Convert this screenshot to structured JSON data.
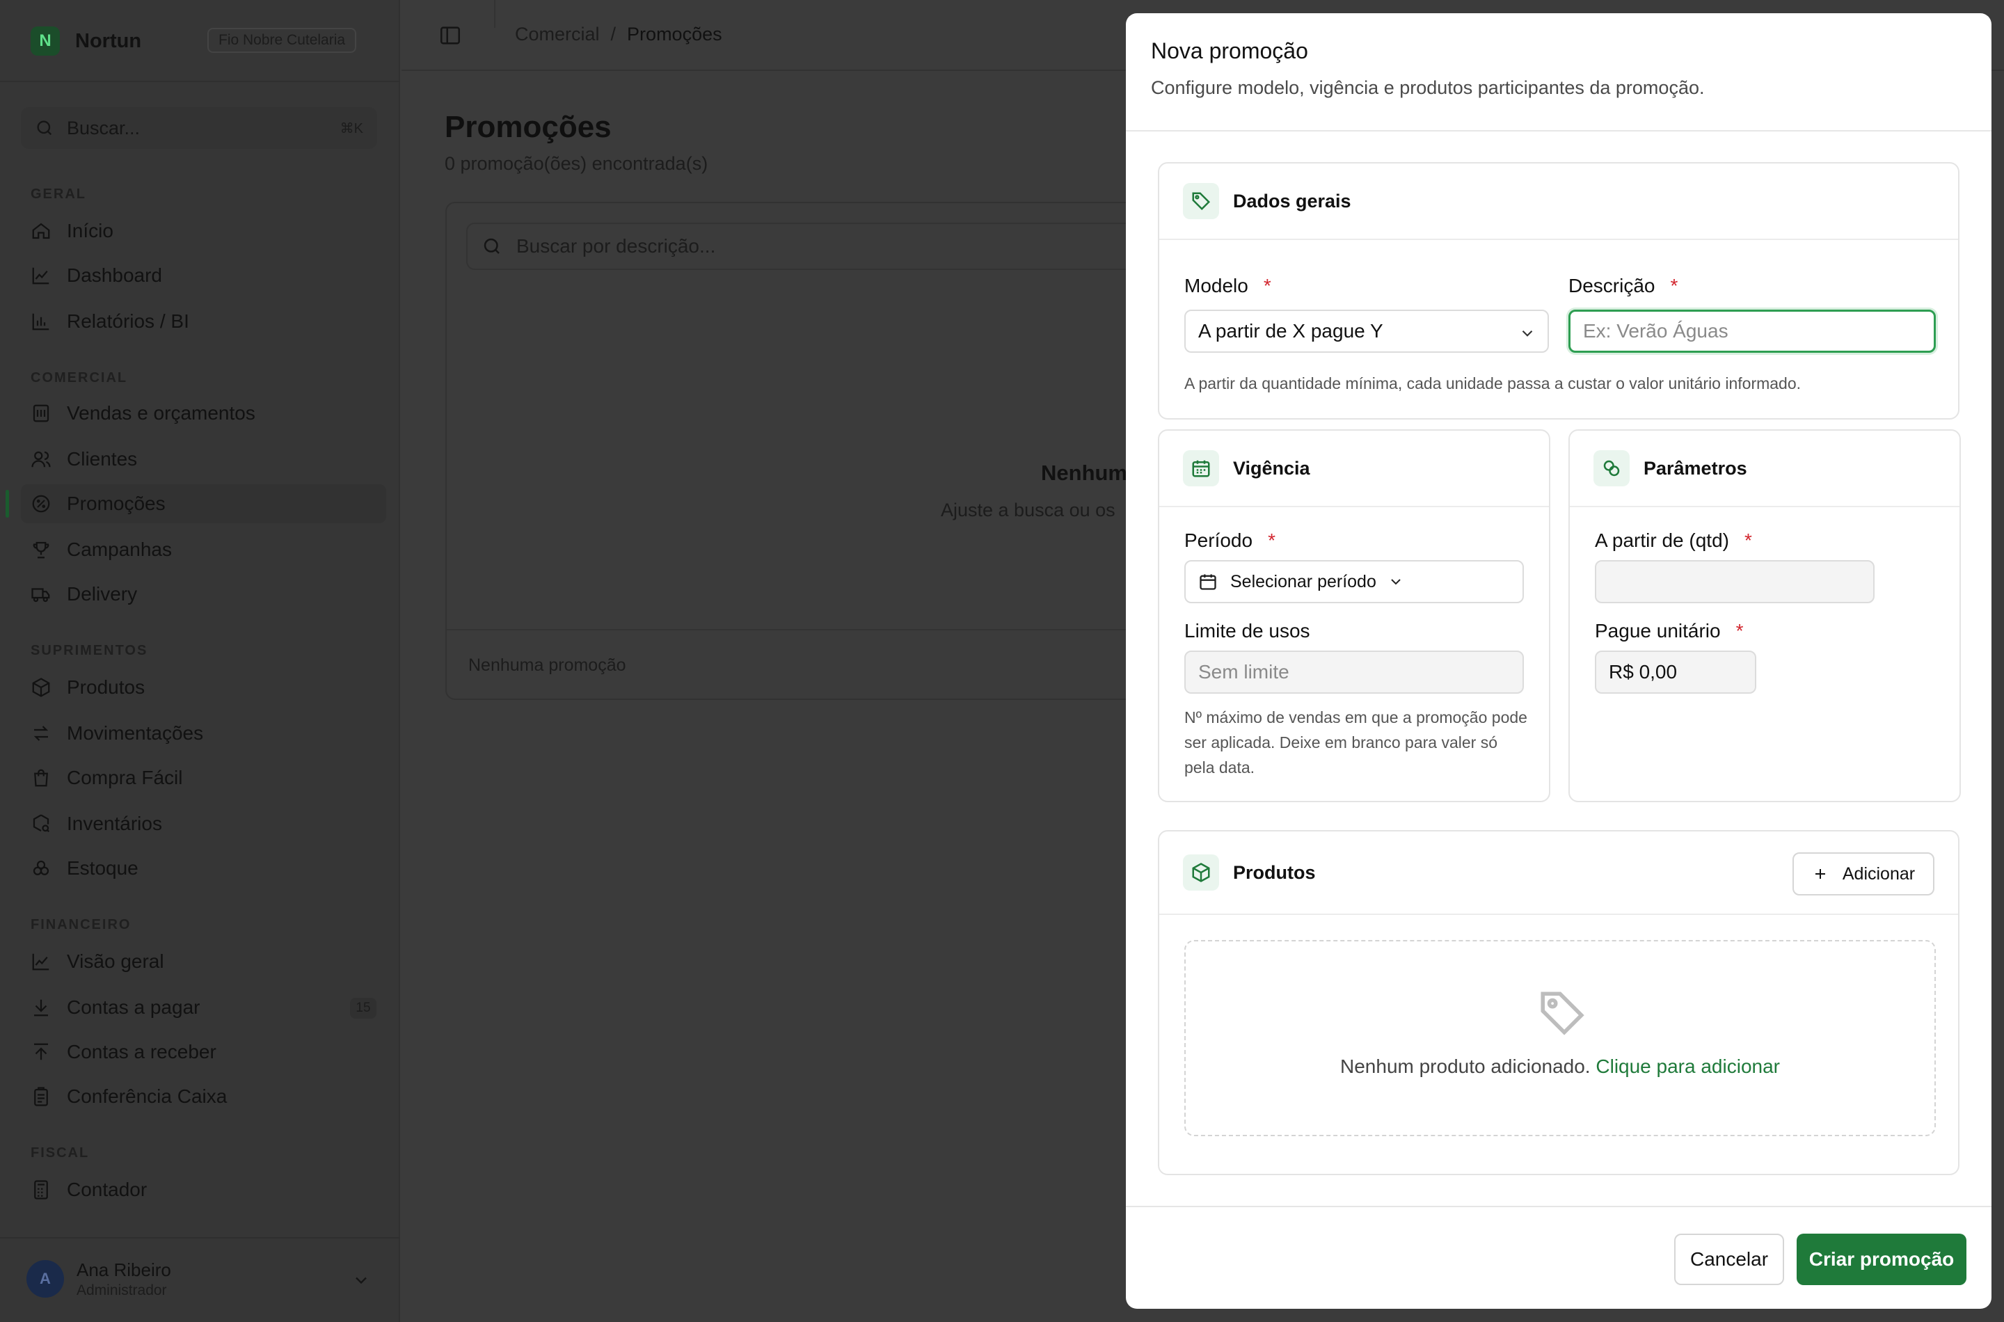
{
  "app": {
    "name": "Nortun",
    "tenant": "Fio Nobre Cutelaria",
    "search_placeholder": "Buscar...",
    "search_shortcut": "⌘K"
  },
  "sidebar": {
    "sections": [
      {
        "title": "GERAL",
        "items": [
          {
            "label": "Início",
            "icon": "home-icon"
          },
          {
            "label": "Dashboard",
            "icon": "line-chart-icon"
          },
          {
            "label": "Relatórios / BI",
            "icon": "bar-chart-icon"
          }
        ]
      },
      {
        "title": "COMERCIAL",
        "items": [
          {
            "label": "Vendas e orçamentos",
            "icon": "receipt-icon"
          },
          {
            "label": "Clientes",
            "icon": "users-icon"
          },
          {
            "label": "Promoções",
            "icon": "discount-icon",
            "active": true
          },
          {
            "label": "Campanhas",
            "icon": "trophy-icon"
          },
          {
            "label": "Delivery",
            "icon": "truck-icon"
          }
        ]
      },
      {
        "title": "SUPRIMENTOS",
        "items": [
          {
            "label": "Produtos",
            "icon": "package-icon"
          },
          {
            "label": "Movimentações",
            "icon": "arrows-icon"
          },
          {
            "label": "Compra Fácil",
            "icon": "shopping-bag-icon"
          },
          {
            "label": "Inventários",
            "icon": "box-search-icon"
          },
          {
            "label": "Estoque",
            "icon": "boxes-icon"
          }
        ]
      },
      {
        "title": "FINANCEIRO",
        "items": [
          {
            "label": "Visão geral",
            "icon": "line-chart-icon"
          },
          {
            "label": "Contas a pagar",
            "icon": "download-icon",
            "badge": "15"
          },
          {
            "label": "Contas a receber",
            "icon": "upload-icon"
          },
          {
            "label": "Conferência Caixa",
            "icon": "clipboard-icon"
          }
        ]
      },
      {
        "title": "FISCAL",
        "items": [
          {
            "label": "Contador",
            "icon": "calculator-icon"
          }
        ]
      }
    ],
    "user": {
      "initial": "A",
      "name": "Ana Ribeiro",
      "role": "Administrador"
    }
  },
  "breadcrumb": {
    "parent": "Comercial",
    "separator": "/",
    "current": "Promoções"
  },
  "page": {
    "title": "Promoções",
    "count_text": "0 promoção(ões) encontrada(s)",
    "search_placeholder": "Buscar por descrição...",
    "empty_title": "Nenhum",
    "empty_sub": "Ajuste a busca ou os",
    "footer": "Nenhuma promoção"
  },
  "dialog": {
    "title": "Nova promoção",
    "subtitle": "Configure modelo, vigência e produtos participantes da promoção.",
    "general": {
      "header": "Dados gerais",
      "model_label": "Modelo",
      "model_value": "A partir de X pague Y",
      "description_label": "Descrição",
      "description_placeholder": "Ex: Verão Águas",
      "hint": "A partir da quantidade mínima, cada unidade passa a custar o valor unitário informado.",
      "required_mark": "*"
    },
    "validity": {
      "header": "Vigência",
      "period_label": "Período",
      "period_value": "Selecionar período",
      "limit_label": "Limite de usos",
      "limit_placeholder": "Sem limite",
      "hint": "Nº máximo de vendas em que a promoção pode ser aplicada. Deixe em branco para valer só pela data."
    },
    "params": {
      "header": "Parâmetros",
      "qty_label": "A partir de (qtd)",
      "qty_value": "",
      "unit_label": "Pague unitário",
      "unit_value": "R$ 0,00"
    },
    "products": {
      "header": "Produtos",
      "add_label": "Adicionar",
      "empty_text": "Nenhum produto adicionado.",
      "empty_link": "Clique para adicionar"
    },
    "footer": {
      "cancel": "Cancelar",
      "submit": "Criar promoção"
    }
  },
  "colors": {
    "accent": "#1f7a3a",
    "required": "#d2262f",
    "overlay": "#3b3b3b"
  }
}
